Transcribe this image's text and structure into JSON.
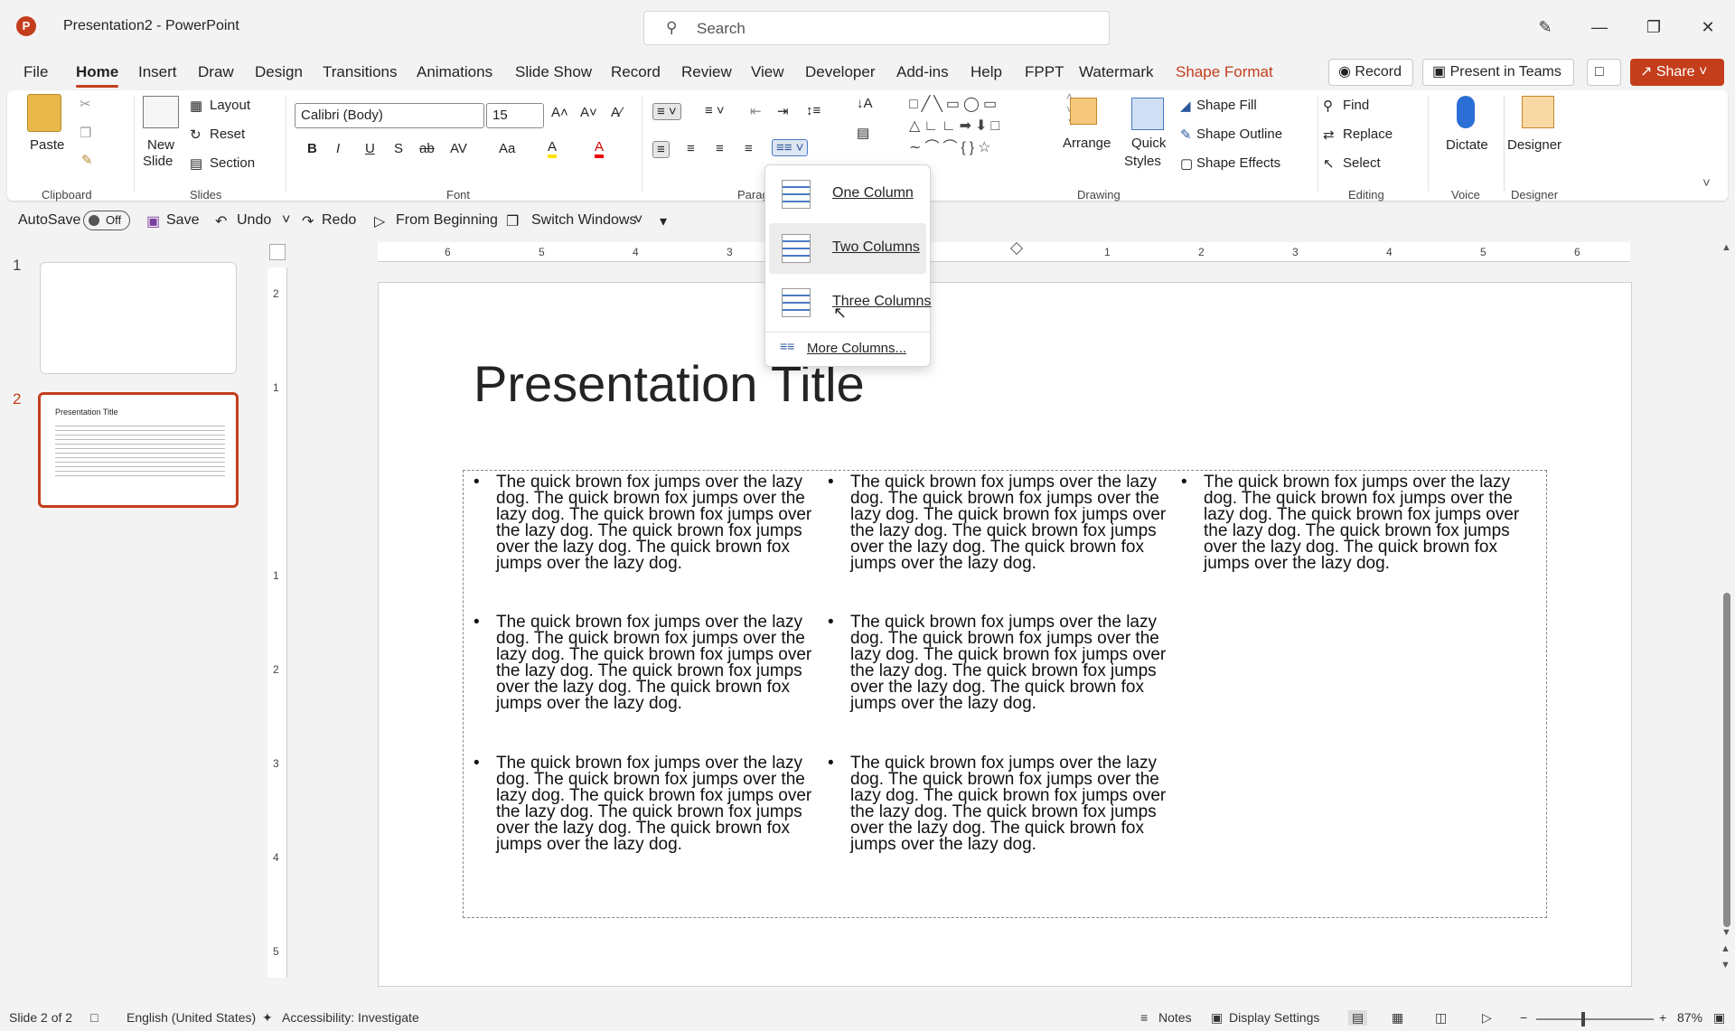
{
  "window": {
    "app_logo": "P",
    "title": "Presentation2 - PowerPoint",
    "search_placeholder": "Search"
  },
  "menu": {
    "tabs": [
      "File",
      "Home",
      "Insert",
      "Draw",
      "Design",
      "Transitions",
      "Animations",
      "Slide Show",
      "Record",
      "Review",
      "View",
      "Developer",
      "Add-ins",
      "Help",
      "FPPT",
      "Watermark",
      "Shape Format"
    ],
    "active_tab": "Home",
    "record_btn": "Record",
    "present_btn": "Present in Teams",
    "share_btn": "Share"
  },
  "ribbon": {
    "clipboard": {
      "paste": "Paste",
      "label": "Clipboard"
    },
    "slides": {
      "new_slide_1": "New",
      "new_slide_2": "Slide",
      "layout": "Layout",
      "reset": "Reset",
      "section": "Section",
      "label": "Slides"
    },
    "font": {
      "family": "Calibri (Body)",
      "size": "15",
      "bold": "B",
      "italic": "I",
      "underline": "U",
      "shadow": "S",
      "strike": "ab",
      "spacing": "AV",
      "case": "Aa",
      "highlight": "A",
      "color": "A",
      "grow": "A^",
      "shrink": "Aˇ",
      "label": "Font"
    },
    "paragraph": {
      "label": "Paragr"
    },
    "drawing": {
      "arrange": "Arrange",
      "quick_styles_1": "Quick",
      "quick_styles_2": "Styles",
      "shape_fill": "Shape Fill",
      "shape_outline": "Shape Outline",
      "shape_effects": "Shape Effects",
      "label": "Drawing"
    },
    "editing": {
      "find": "Find",
      "replace": "Replace",
      "select": "Select",
      "label": "Editing"
    },
    "voice": {
      "dictate": "Dictate",
      "label": "Voice"
    },
    "designer": {
      "designer": "Designer",
      "label": "Designer"
    }
  },
  "qat": {
    "autosave": "AutoSave",
    "toggle": "Off",
    "save": "Save",
    "undo": "Undo",
    "redo": "Redo",
    "from_beginning": "From Beginning",
    "switch_windows": "Switch Windows"
  },
  "columns_menu": {
    "items": [
      "One Column",
      "Two Columns",
      "Three Columns"
    ],
    "more": "More Columns..."
  },
  "thumbnails": {
    "n1": "1",
    "n2": "2",
    "thumb_title": "Presentation Title"
  },
  "hruler_labels": [
    "6",
    "5",
    "4",
    "3",
    "1",
    "2",
    "3",
    "4",
    "5",
    "6"
  ],
  "vruler_labels": [
    "2",
    "1",
    "1",
    "2",
    "3",
    "4",
    "5"
  ],
  "slide": {
    "title": "Presentation Title",
    "bullet": "The quick brown fox jumps over the lazy dog. The quick brown fox jumps over the lazy dog. The quick brown fox jumps over the lazy dog. The quick brown fox jumps over the lazy dog. The quick brown fox jumps over the lazy dog."
  },
  "status": {
    "slide": "Slide 2 of 2",
    "language": "English (United States)",
    "accessibility": "Accessibility: Investigate",
    "notes": "Notes",
    "display": "Display Settings",
    "zoom": "87%"
  },
  "colors": {
    "accent": "#c43e1c",
    "ribbon_bg": "#ffffff",
    "app_bg": "#f3f3f3"
  }
}
